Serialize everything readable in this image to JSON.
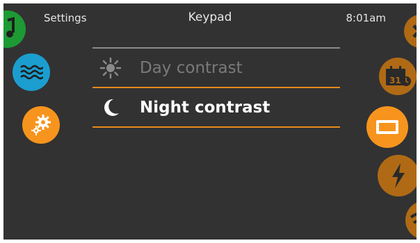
{
  "header": {
    "left": "Settings",
    "title": "Keypad",
    "time": "8:01am"
  },
  "contrast_options": [
    {
      "label": "Day contrast",
      "icon": "sun-icon",
      "selected": false
    },
    {
      "label": "Night contrast",
      "icon": "moon-icon",
      "selected": true
    }
  ],
  "left_nav": [
    {
      "icon": "music-icon"
    },
    {
      "icon": "water-waves-icon"
    },
    {
      "icon": "gears-icon"
    }
  ],
  "right_nav": [
    {
      "icon": "light-icon"
    },
    {
      "icon": "calendar-clock-icon",
      "calendar_day": "31"
    },
    {
      "icon": "keypad-screen-icon"
    },
    {
      "icon": "lightning-icon"
    },
    {
      "icon": "wifi-icon"
    }
  ],
  "colors": {
    "background": "#323232",
    "accent": "#f7941d",
    "blue": "#1b9ecf",
    "green": "#1d9a34",
    "divider": "#e8891c"
  }
}
